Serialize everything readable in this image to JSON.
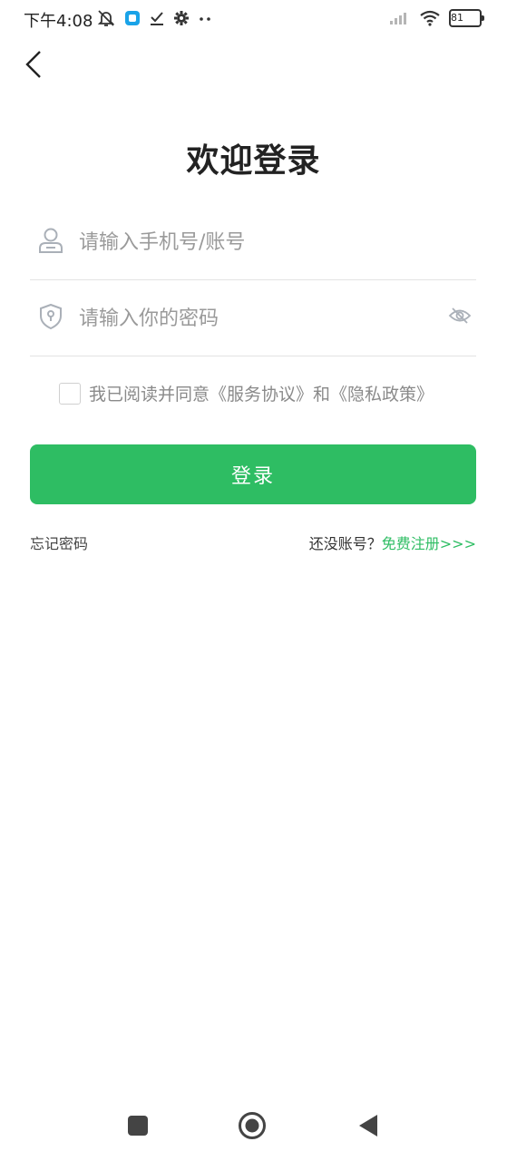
{
  "status_bar": {
    "time": "下午4:08",
    "battery": "81",
    "icons": [
      "mute-icon",
      "app-icon",
      "task-done-icon",
      "settings-gear-icon",
      "more-dots-icon",
      "signal-icon",
      "wifi-icon",
      "battery-icon"
    ],
    "app_icon_color": "#1aa3e8"
  },
  "header": {
    "back_icon": "chevron-left-icon",
    "title": "欢迎登录"
  },
  "form": {
    "phone_placeholder": "请输入手机号/账号",
    "phone_value": "",
    "phone_icon": "user-icon",
    "password_placeholder": "请输入你的密码",
    "password_value": "",
    "password_icon": "shield-lock-icon",
    "eye_icon": "eye-off-icon"
  },
  "agreement": {
    "checked": false,
    "prefix": "我已阅读并同意",
    "service_link": "《服务协议》",
    "conjunction": "和",
    "privacy_link": "《隐私政策》"
  },
  "login_button": "登录",
  "footer_links": {
    "forgot": "忘记密码",
    "no_account": "还没账号？",
    "register": "免费注册>>>"
  },
  "nav_bar": {
    "icons": [
      "recents-square-icon",
      "home-circle-icon",
      "back-triangle-icon"
    ]
  },
  "colors": {
    "accent": "#2ebd63",
    "background": "#ffffff",
    "text_primary": "#222222",
    "placeholder": "#9a9a9a"
  }
}
